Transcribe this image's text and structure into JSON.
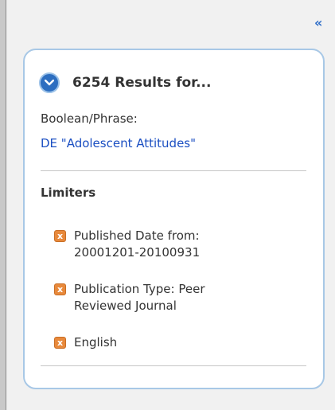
{
  "sidebar": {
    "collapse_label": "«"
  },
  "results": {
    "count_title": "6254 Results for...",
    "search_mode_label": "Boolean/Phrase:",
    "query": "DE \"Adolescent Attitudes\""
  },
  "limiters": {
    "title": "Limiters",
    "remove_label": "x",
    "items": [
      {
        "text": "Published Date from: 20001201-20100931"
      },
      {
        "text": "Publication Type: Peer Reviewed Journal"
      },
      {
        "text": "English"
      }
    ]
  },
  "colors": {
    "accent_blue": "#2d6ec0",
    "link_blue": "#1b4fc2",
    "remove_orange": "#e8893b",
    "panel_border": "#a8c8e6"
  }
}
